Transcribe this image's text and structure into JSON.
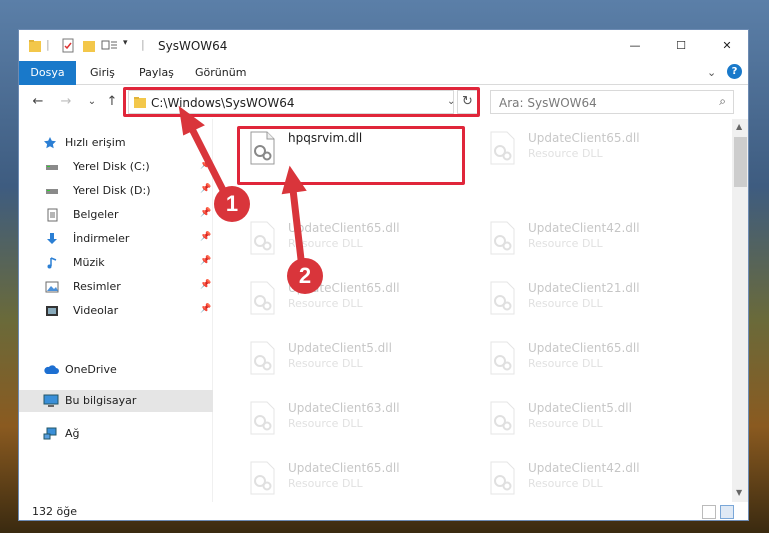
{
  "window": {
    "title": "SysWOW64",
    "minimize_glyph": "—",
    "maximize_glyph": "☐",
    "close_glyph": "✕"
  },
  "ribbon": {
    "tabs": [
      {
        "label": "Dosya"
      },
      {
        "label": "Giriş"
      },
      {
        "label": "Paylaş"
      },
      {
        "label": "Görünüm"
      }
    ],
    "collapse_glyph": "⌄",
    "help_glyph": "?"
  },
  "navigation": {
    "back_glyph": "←",
    "forward_glyph": "→",
    "recent_glyph": "⌄",
    "up_glyph": "↑",
    "address": "C:\\Windows\\SysWOW64",
    "address_drop_glyph": "⌄",
    "refresh_glyph": "↻",
    "search_placeholder": "Ara: SysWOW64",
    "search_glyph": "⌕"
  },
  "sidebar": {
    "items": [
      {
        "label": "Hızlı erişim",
        "icon": "star-icon",
        "pinned": false
      },
      {
        "label": "Yerel Disk (C:)",
        "icon": "drive-icon",
        "pinned": true
      },
      {
        "label": "Yerel Disk (D:)",
        "icon": "drive-icon",
        "pinned": true
      },
      {
        "label": "Belgeler",
        "icon": "documents-icon",
        "pinned": true
      },
      {
        "label": "İndirmeler",
        "icon": "download-icon",
        "pinned": true
      },
      {
        "label": "Müzik",
        "icon": "music-icon",
        "pinned": true
      },
      {
        "label": "Resimler",
        "icon": "pictures-icon",
        "pinned": true
      },
      {
        "label": "Videolar",
        "icon": "videos-icon",
        "pinned": true
      },
      {
        "label": "OneDrive",
        "icon": "cloud-icon",
        "pinned": false
      },
      {
        "label": "Bu bilgisayar",
        "icon": "computer-icon",
        "pinned": false
      },
      {
        "label": "Ağ",
        "icon": "network-icon",
        "pinned": false
      }
    ],
    "pin_glyph": "📌"
  },
  "files": {
    "left_column": [
      {
        "name": "hpqsrvim.dll",
        "desc": ""
      },
      {
        "name": "UpdateClient65.dll",
        "desc": "Resource DLL"
      },
      {
        "name": "UpdateClient65.dll",
        "desc": "Resource DLL"
      },
      {
        "name": "UpdateClient5.dll",
        "desc": "Resource DLL"
      },
      {
        "name": "UpdateClient63.dll",
        "desc": "Resource DLL"
      },
      {
        "name": "UpdateClient65.dll",
        "desc": "Resource DLL"
      }
    ],
    "right_column": [
      {
        "name": "UpdateClient65.dll",
        "desc": "Resource DLL"
      },
      {
        "name": "UpdateClient42.dll",
        "desc": "Resource DLL"
      },
      {
        "name": "UpdateClient21.dll",
        "desc": "Resource DLL"
      },
      {
        "name": "UpdateClient65.dll",
        "desc": "Resource DLL"
      },
      {
        "name": "UpdateClient5.dll",
        "desc": "Resource DLL"
      },
      {
        "name": "UpdateClient42.dll",
        "desc": "Resource DLL"
      }
    ]
  },
  "status": {
    "item_count": "132 öğe"
  },
  "annotations": {
    "step1": "1",
    "step2": "2",
    "color": "#d9353b"
  },
  "colors": {
    "accent": "#1979ca",
    "highlight": "#e0263a"
  }
}
